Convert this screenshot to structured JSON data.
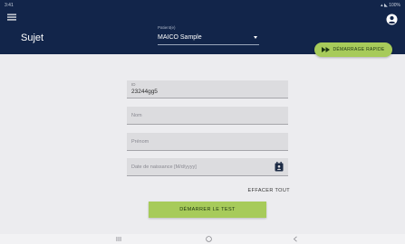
{
  "status_bar": {
    "left": "3:41",
    "right": "▴ ◣ 100%"
  },
  "app_bar": {
    "title": "Sujet",
    "patient_label": "Patient(e)",
    "patient_value": "MAICO Sample",
    "icons": [
      "menu-icon",
      "account-icon",
      "chevron-down-icon"
    ]
  },
  "quick_start": {
    "label": "DÉMARRAGE RAPIDE",
    "icon": "fast-forward-icon"
  },
  "form": {
    "id": {
      "label": "ID",
      "value": "23244gg5"
    },
    "nom": {
      "placeholder": "Nom"
    },
    "prenom": {
      "placeholder": "Prénom"
    },
    "birthdate": {
      "placeholder": "Date de naissance  [M/d/yyyy]",
      "icon": "calendar-icon"
    },
    "clear_label": "EFFACER TOUT",
    "start_label": "DÉMARRER LE TEST"
  },
  "nav_bar": {
    "icons": [
      "recent-apps-icon",
      "home-icon",
      "back-icon"
    ]
  },
  "colors": {
    "app_bar": "#12254a",
    "accent_green": "#a7cb5a",
    "background": "#ececef",
    "field": "#dcdcdf"
  }
}
